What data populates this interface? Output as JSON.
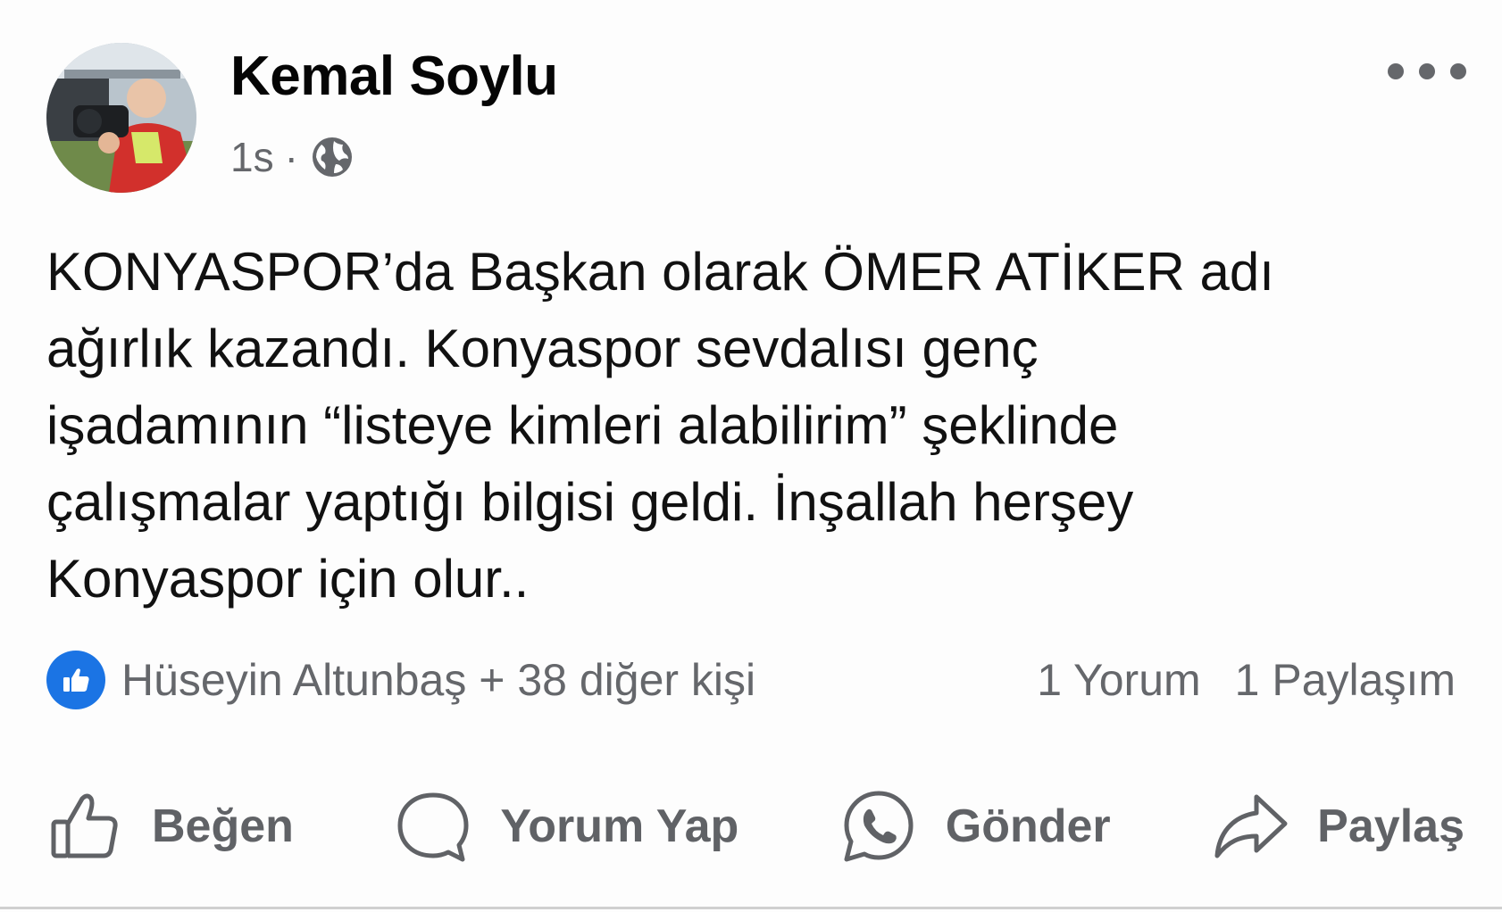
{
  "post": {
    "author": "Kemal Soylu",
    "time": "1s",
    "separator": "·",
    "privacy_icon": "globe-icon",
    "more_icon": "more-dots-icon",
    "text_lines": [
      "KONYASPOR’da Başkan olarak ÖMER ATİKER adı",
      "ağırlık kazandı. Konyaspor sevdalısı genç",
      "işadamının “listeye kimleri alabilirim” şeklinde",
      "çalışmalar yaptığı bilgisi geldi. İnşallah herşey",
      "Konyaspor için olur.."
    ]
  },
  "stats": {
    "reaction_icon": "like-reaction-icon",
    "reactions_text": "Hüseyin Altunbaş + 38 diğer kişi",
    "comments": "1 Yorum",
    "shares": "1 Paylaşım"
  },
  "actions": [
    {
      "label": "Beğen",
      "icon": "like-icon"
    },
    {
      "label": "Yorum Yap",
      "icon": "comment-icon"
    },
    {
      "label": "Gönder",
      "icon": "whatsapp-icon"
    },
    {
      "label": "Paylaş",
      "icon": "share-icon"
    }
  ],
  "colors": {
    "accent": "#1b74e4",
    "text": "#111111",
    "secondary_text": "#65676b",
    "action_text": "#606266"
  }
}
